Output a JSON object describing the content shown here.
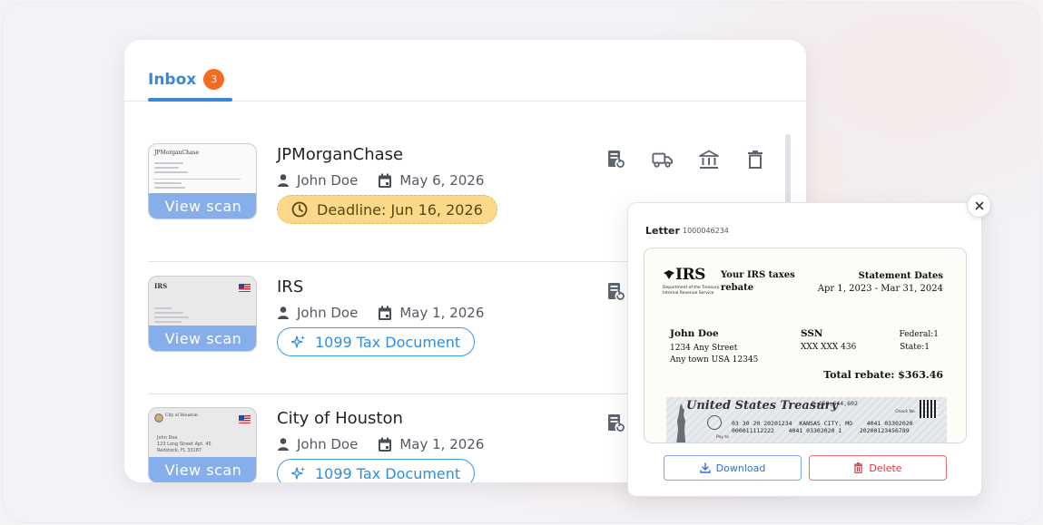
{
  "inbox": {
    "tab_label": "Inbox",
    "badge_count": "3"
  },
  "mails": [
    {
      "sender": "JPMorganChase",
      "recipient": "John Doe",
      "date": "May 6, 2026",
      "chip_type": "deadline",
      "chip_label": "Deadline: Jun 16, 2026",
      "view_scan_label": "View scan",
      "thumb_brand": "JPMorganChase"
    },
    {
      "sender": "IRS",
      "recipient": "John Doe",
      "date": "May 1, 2026",
      "chip_type": "tax",
      "chip_label": "1099 Tax Document",
      "view_scan_label": "View scan",
      "thumb_brand": "IRS"
    },
    {
      "sender": "City of Houston",
      "recipient": "John Doe",
      "date": "May 1, 2026",
      "chip_type": "tax",
      "chip_label": "1099 Tax Document",
      "view_scan_label": "View scan",
      "thumb_brand": "City of Houston",
      "thumb_address": [
        "John Doe",
        "123 Long Street Apt. 45",
        "Redstock, FL 33187"
      ]
    }
  ],
  "preview": {
    "title": "Letter",
    "letter_id": "1000046234",
    "close_icon": "close-icon",
    "letter": {
      "logo": "IRS",
      "dept_line1": "Department of the Treasury",
      "dept_line2": "Internal Revenue Service",
      "heading": "Your IRS taxes rebate",
      "statement_label": "Statement Dates",
      "statement_dates": "Apr 1, 2023 - Mar 31, 2024",
      "name": "John Doe",
      "address_line1": "1234 Any Street",
      "address_line2": "Any town USA 12345",
      "ssn_label": "SSN",
      "ssn_value": "XXX XXX 436",
      "federal": "Federal:1",
      "state": "State:1",
      "total": "Total rebate: $363.46",
      "check_title": "United States Treasury",
      "check_number": "B 158,644,602",
      "check_line1": "03 30 20 20201234  KANSAS CITY, MO    4041 03302020",
      "check_line2": "000011112222    4041 03302020 1     20200123456789",
      "check_no_label": "Check No.",
      "pay_to_label": "Pay to"
    },
    "download_label": "Download",
    "delete_label": "Delete"
  },
  "colors": {
    "accent": "#3a86d9",
    "badge": "#f26b21",
    "deadline_bg": "#fcd98a",
    "delete": "#d9363e"
  }
}
